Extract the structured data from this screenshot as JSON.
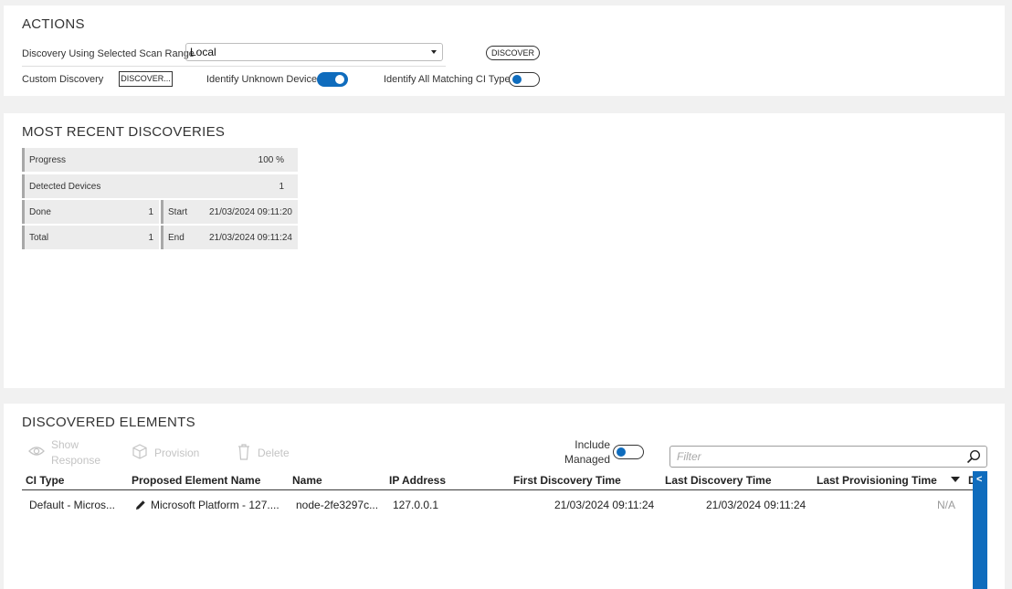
{
  "actions": {
    "title": "ACTIONS",
    "scan_range_label": "Discovery Using Selected Scan Range",
    "scan_range_value": "Local",
    "discover_button": "DISCOVER",
    "custom_discovery_label": "Custom Discovery",
    "custom_discover_button": "DISCOVER...",
    "identify_unknown_label": "Identify Unknown Devices",
    "identify_unknown_on": true,
    "identify_all_label": "Identify All Matching CI Types",
    "identify_all_on": false
  },
  "recent": {
    "title": "MOST RECENT DISCOVERIES",
    "progress_label": "Progress",
    "progress_value": "100 %",
    "detected_label": "Detected Devices",
    "detected_value": "1",
    "done_label": "Done",
    "done_value": "1",
    "total_label": "Total",
    "total_value": "1",
    "start_label": "Start",
    "start_value": "21/03/2024 09:11:20",
    "end_label": "End",
    "end_value": "21/03/2024 09:11:24"
  },
  "discovered": {
    "title": "DISCOVERED ELEMENTS",
    "show_response_line1": "Show",
    "show_response_line2": "Response",
    "provision": "Provision",
    "delete": "Delete",
    "include_managed_line1": "Include",
    "include_managed_line2": "Managed",
    "include_managed_on": false,
    "filter_placeholder": "Filter",
    "columns": [
      "CI Type",
      "Proposed Element Name",
      "Name",
      "IP Address",
      "First Discovery Time",
      "Last Discovery Time",
      "Last Provisioning Time",
      "D"
    ],
    "rows": [
      {
        "ci_type": "Default - Micros...",
        "proposed_name": "Microsoft Platform - 127....",
        "name": "node-2fe3297c...",
        "ip": "127.0.0.1",
        "first_time": "21/03/2024 09:11:24",
        "last_time": "21/03/2024 09:11:24",
        "provisioning_time": "N/A"
      }
    ],
    "side_toggle": "<"
  },
  "colors": {
    "accent": "#0f6cbd",
    "page_bg": "#f1f1f1"
  }
}
